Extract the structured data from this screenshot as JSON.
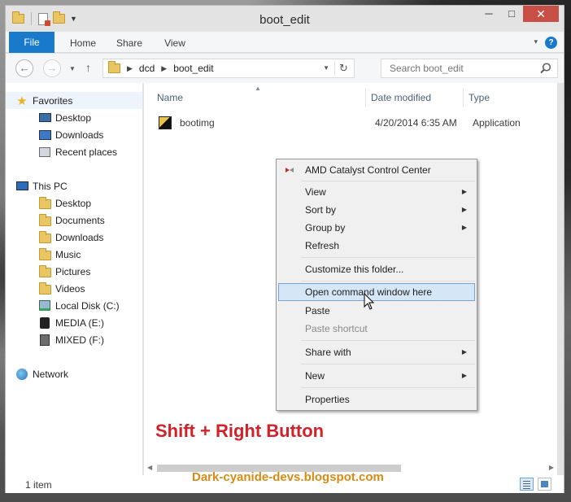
{
  "window": {
    "title": "boot_edit",
    "minimize": "─",
    "maximize": "□",
    "close": "✕"
  },
  "ribbon": {
    "tabs": [
      "File",
      "Home",
      "Share",
      "View"
    ],
    "help": "?"
  },
  "navigation": {
    "back": "←",
    "forward": "→",
    "up": "↑",
    "breadcrumb": [
      "dcd",
      "boot_edit"
    ],
    "search_placeholder": "Search boot_edit"
  },
  "nav_pane": {
    "favorites": {
      "label": "Favorites",
      "items": [
        "Desktop",
        "Downloads",
        "Recent places"
      ]
    },
    "this_pc": {
      "label": "This PC",
      "items": [
        "Desktop",
        "Documents",
        "Downloads",
        "Music",
        "Pictures",
        "Videos",
        "Local Disk (C:)",
        "MEDIA (E:)",
        "MIXED (F:)"
      ]
    },
    "network": {
      "label": "Network"
    }
  },
  "file_list": {
    "columns": [
      "Name",
      "Date modified",
      "Type"
    ],
    "rows": [
      {
        "name": "bootimg",
        "date_modified": "4/20/2014 6:35 AM",
        "type": "Application"
      }
    ]
  },
  "context_menu": {
    "items": [
      {
        "label": "AMD Catalyst Control Center"
      },
      {
        "label": "View",
        "submenu": true
      },
      {
        "label": "Sort by",
        "submenu": true
      },
      {
        "label": "Group by",
        "submenu": true
      },
      {
        "label": "Refresh"
      },
      {
        "label": "Customize this folder..."
      },
      {
        "label": "Open command window here",
        "highlighted": true
      },
      {
        "label": "Paste"
      },
      {
        "label": "Paste shortcut",
        "disabled": true
      },
      {
        "label": "Share with",
        "submenu": true
      },
      {
        "label": "New",
        "submenu": true
      },
      {
        "label": "Properties"
      }
    ]
  },
  "status_bar": {
    "item_count": "1 item"
  },
  "overlay": {
    "instruction": "Shift + Right Button",
    "watermark": "Dark-cyanide-devs.blogspot.com"
  },
  "colors": {
    "file_tab": "#1979ca",
    "close_button": "#c74f45",
    "highlight": "#d5e6f7",
    "instruction_text": "#d1222a",
    "watermark_text": "#d88b14"
  }
}
